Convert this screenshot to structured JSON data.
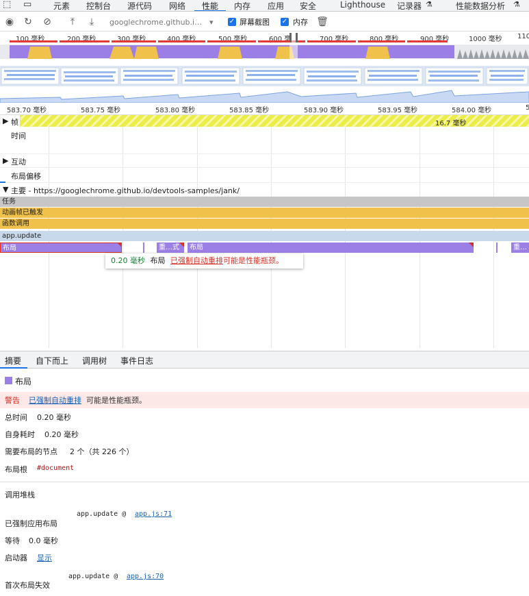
{
  "tabs": {
    "elements": "元素",
    "console": "控制台",
    "sources": "源代码",
    "network": "网络",
    "performance": "性能",
    "memory": "内存",
    "application": "应用",
    "security": "安全",
    "lighthouse": "Lighthouse",
    "recorder": "记录器",
    "perf_insights": "性能数据分析"
  },
  "toolbar": {
    "url": "googlechrome.github.i…",
    "screenshots_label": "屏幕截图",
    "memory_label": "内存"
  },
  "overview": {
    "ticks": [
      "100 毫秒",
      "200 毫秒",
      "300 毫秒",
      "400 毫秒",
      "500 毫秒",
      "600 毫",
      "700 毫秒",
      "800 毫秒",
      "900 毫秒",
      "1000 毫秒",
      "110"
    ]
  },
  "ruler": {
    "ticks": [
      "583.70 毫秒",
      "583.75 毫秒",
      "583.80 毫秒",
      "583.85 毫秒",
      "583.90 毫秒",
      "583.95 毫秒",
      "584.00 毫秒",
      "5"
    ]
  },
  "tracks": {
    "frames": "帧",
    "frame_duration": "16.7 毫秒",
    "timings": "时间",
    "interactions": "互动",
    "layout_shifts": "布局偏移",
    "main": "主要 - https://googlechrome.github.io/devtools-samples/jank/"
  },
  "flame": {
    "task": "任务",
    "animation_frame": "动画帧已触发",
    "function_call": "函数调用",
    "app_update": "app.update",
    "layout1": "布局",
    "recalc": "重…式",
    "layout2": "布局",
    "recalc2": "重…"
  },
  "tooltip": {
    "duration": "0.20 毫秒",
    "name": "布局",
    "link": "已强制自动重排",
    "rest": "可能是性能瓶颈。"
  },
  "details_tabs": {
    "summary": "摘要",
    "bottom_up": "自下而上",
    "call_tree": "调用树",
    "event_log": "事件日志"
  },
  "summary": {
    "title": "布局",
    "warning_label": "警告",
    "warning_link": "已强制自动重排",
    "warning_rest": "可能是性能瓶颈。",
    "total_time_label": "总时间",
    "total_time": "0.20 毫秒",
    "self_time_label": "自身耗时",
    "self_time": "0.20 毫秒",
    "nodes_label": "需要布局的节点",
    "nodes_value": "2 个（共 226 个）",
    "root_label": "布局根",
    "root_value": "#document",
    "stack_title": "调用堆栈",
    "forced_label": "已强制应用布局",
    "forced_fn": "app.update @ ",
    "forced_link": "app.js:71",
    "pending_label": "等待",
    "pending_value": "0.0 毫秒",
    "initiator_label": "启动器",
    "initiator_link": "显示",
    "first_invalid_label": "首次布局失效",
    "first_invalid_fn": "app.update @ ",
    "first_invalid_link": "app.js:70"
  },
  "colors": {
    "accent": "#1a73e8",
    "purple": "#9b7fe6",
    "yellow": "#f0c24b",
    "frame_yellow": "#eded4a",
    "task_gray": "#c6c6c6",
    "app_blue": "#c9d9ec",
    "red": "#d93025",
    "green": "#188038",
    "warning_bg": "#fce8e6"
  }
}
